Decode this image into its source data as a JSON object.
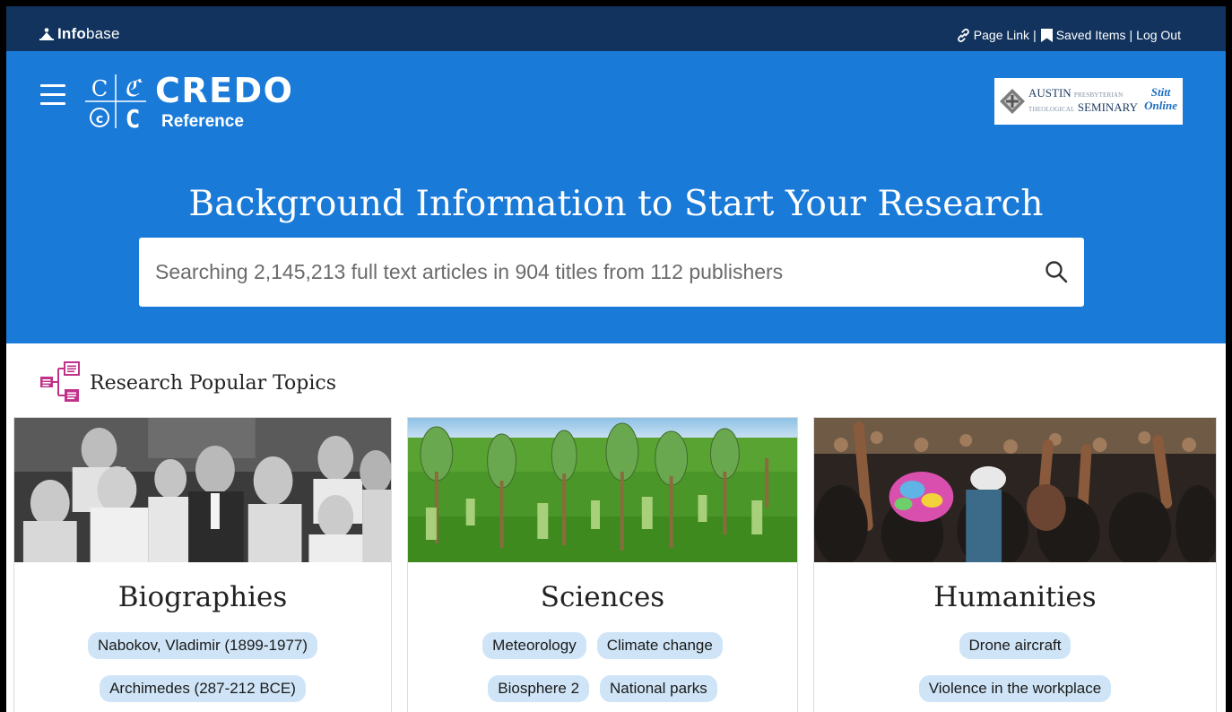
{
  "topbar": {
    "brand_bold": "Info",
    "brand_light": "base",
    "page_link": "Page Link",
    "separator": "|",
    "saved_items": "Saved Items",
    "log_out": "Log Out"
  },
  "header": {
    "credo_word": "CREDO",
    "credo_sub": "Reference",
    "partner": {
      "name_main": "AUSTIN",
      "name_small_1": "PRESBYTERIAN",
      "name_small_2": "THEOLOGICAL",
      "name_main_2": "SEMINARY",
      "stitt_1": "Stitt",
      "stitt_2": "Online"
    }
  },
  "hero": {
    "title": "Background Information to Start Your Research",
    "search_placeholder": "Searching 2,145,213 full text articles in 904 titles from 112 publishers"
  },
  "topics": {
    "heading": "Research Popular Topics",
    "cards": [
      {
        "title": "Biographies",
        "rows": [
          [
            "Nabokov, Vladimir (1899-1977)"
          ],
          [
            "Archimedes (287-212 BCE)"
          ]
        ]
      },
      {
        "title": "Sciences",
        "rows": [
          [
            "Meteorology",
            "Climate change"
          ],
          [
            "Biosphere 2",
            "National parks"
          ]
        ]
      },
      {
        "title": "Humanities",
        "rows": [
          [
            "Drone aircraft"
          ],
          [
            "Violence in the workplace"
          ]
        ]
      }
    ]
  },
  "colors": {
    "topbar": "#12335e",
    "hero": "#1a7ad8",
    "chip": "#cfe5f7",
    "topics_icon": "#c0318a"
  },
  "icons": {
    "infobase": "person-mountain-icon",
    "page_link": "chain-link-icon",
    "saved_items": "bookmark-icon",
    "menu": "hamburger-menu-icon",
    "search": "magnifier-icon",
    "topics": "topic-tree-icon"
  }
}
